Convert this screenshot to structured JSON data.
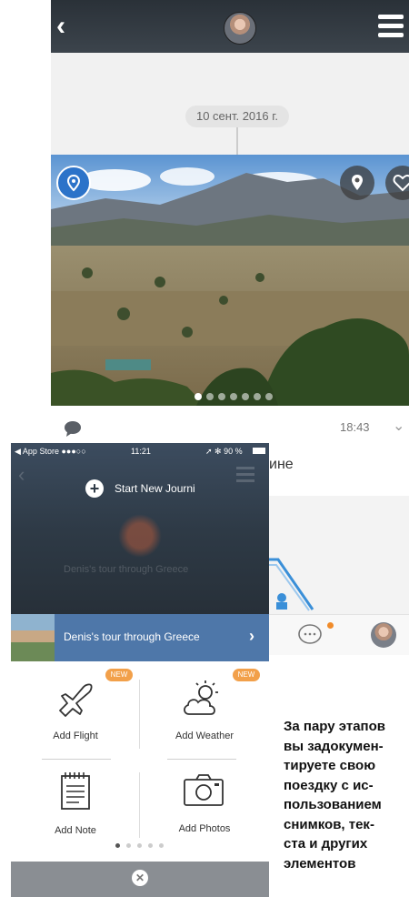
{
  "journal": {
    "date_label": "10 сент. 2016 г.",
    "time": "18:43",
    "partial_text": "ине",
    "photo_dot_count": 7
  },
  "phone": {
    "status": {
      "left": "◀ App Store ●●●○○",
      "time": "11:21",
      "right": "➚ ✻ 90 %"
    },
    "start_new_label": "Start New Journi",
    "trip_title_faded": "Denis's tour through Greece",
    "trip_name": "Denis's tour through Greece",
    "grid": {
      "badge_new": "NEW",
      "add_flight": "Add Flight",
      "add_weather": "Add Weather",
      "add_note": "Add Note",
      "add_photos": "Add Photos"
    },
    "grid_dot_count": 5
  },
  "caption_lines": [
    "За пару этапов",
    "вы задокумен-",
    "тируете свою",
    "поездку с ис-",
    "пользованием",
    "снимков, тек-",
    "ста и других",
    "элементов"
  ],
  "colors": {
    "accent_blue": "#2c73c9",
    "trip_row": "#4e77a9",
    "badge_orange": "#f2a04a"
  }
}
